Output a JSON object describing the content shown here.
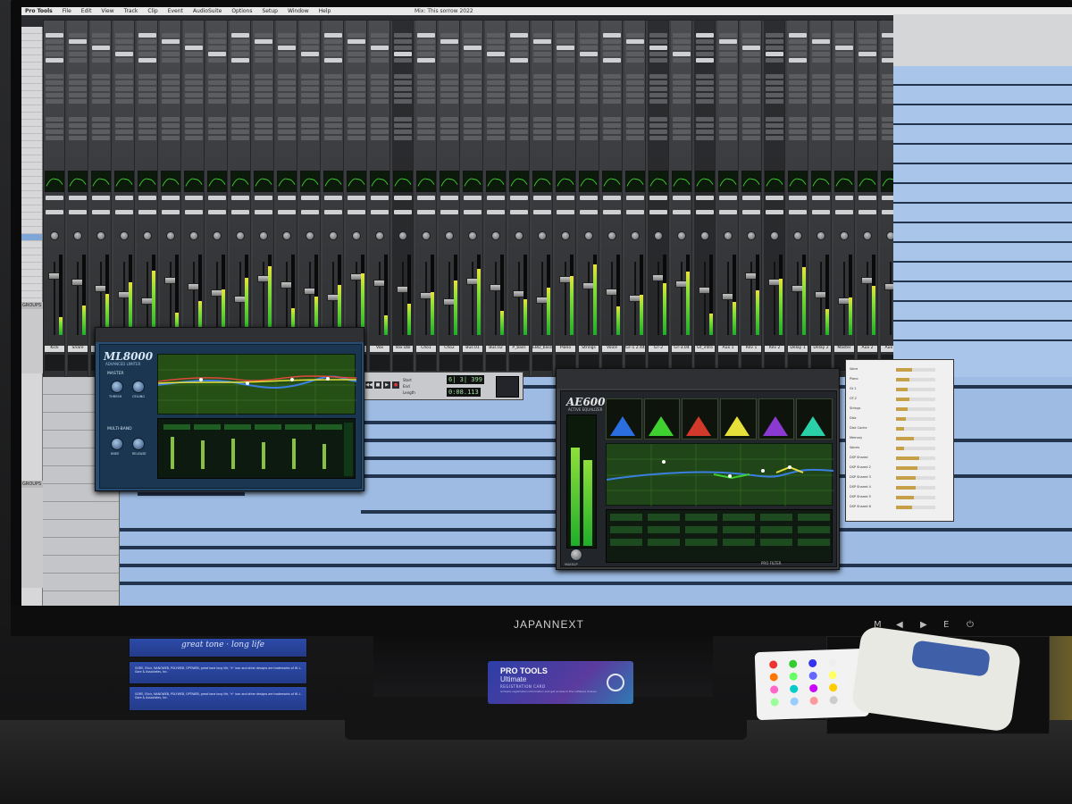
{
  "menubar": {
    "items": [
      "Pro Tools",
      "File",
      "Edit",
      "View",
      "Track",
      "Clip",
      "Event",
      "AudioSuite",
      "Options",
      "Setup",
      "Window",
      "Help"
    ],
    "title": "Mix: This sorrow 2022"
  },
  "tracklist": {
    "groups_label": "GROUPS",
    "groups_label_2": "GROUPS"
  },
  "mixer": {
    "strip_count": 37,
    "strip_names": [
      "Kick",
      "Snare",
      "Hat",
      "Tom1",
      "Tom2",
      "OH",
      "Room",
      "Bass",
      "Gtr1",
      "Gtr2",
      "Gtr3",
      "Keys",
      "Pad",
      "Str",
      "Vox",
      "Vox Dbl",
      "Cho1",
      "Cho2",
      "Bus.01",
      "Bus.02",
      "P_bass",
      "EBD_bass",
      "Piano",
      "Strings",
      "Voice",
      "GT-1 2.44",
      "GT-2",
      "GT-3.04",
      "Gt_intro",
      "Aux 1",
      "Rev 1",
      "Rev 2",
      "Delay 1",
      "Delay 2",
      "Master",
      "Aux 2",
      "Aux 3"
    ],
    "send_label": "SENDS F-J",
    "insert_label": "INSERTS A-E",
    "out_label": "Output 1-2",
    "group_label": "no group"
  },
  "transport": {
    "counter_main": "6| 3| 399",
    "counter_sub": "0:08.113",
    "start_label": "Start",
    "end_label": "End",
    "length_label": "Length"
  },
  "ml8000": {
    "title": "ML8000",
    "subtitle": "ADVANCED LIMITER",
    "master_label": "MASTER",
    "multiband_label": "MULTI-BAND",
    "knob1": "THRESH",
    "knob2": "CEILING",
    "knob3": "KNEE",
    "knob4": "RELEASE"
  },
  "ae600": {
    "title": "AE600",
    "subtitle": "ACTIVE EQUALIZER",
    "footer": "PRO FILTER",
    "makeup_label": "MAKEUP",
    "bands": [
      {
        "color": "#2a6ee0"
      },
      {
        "color": "#3fd12f"
      },
      {
        "color": "#d13a2a"
      },
      {
        "color": "#e6e03a"
      },
      {
        "color": "#8a3ad1"
      },
      {
        "color": "#2ad1a8"
      }
    ]
  },
  "usage": {
    "rows": [
      "Voice",
      "Piano",
      "Gt 1",
      "GT-2",
      "Strings",
      "Disk",
      "Disk Cache",
      "Memory",
      "Voices",
      "DSP Shared",
      "DSP Shared 2",
      "DSP Shared 3",
      "DSP Shared 4",
      "DSP Shared 5",
      "DSP Shared 6"
    ],
    "levels": [
      0.4,
      0.35,
      0.3,
      0.35,
      0.3,
      0.25,
      0.2,
      0.45,
      0.2,
      0.6,
      0.55,
      0.5,
      0.5,
      0.45,
      0.4
    ]
  },
  "monitor": {
    "brand": "JAPANNEXT",
    "osd": [
      "M",
      "◀",
      "▶",
      "E",
      "⏻"
    ]
  },
  "desk": {
    "card_line1": "PRO TOOLS",
    "card_line2": "Ultimate",
    "card_line3": "REGISTRATION CARD",
    "card_line4": "Activate registration information and get access to the software license",
    "strings_top": "great tone · long life",
    "strings_fine1": "GORE, Elixir, NANOWEB, POLYWEB, OPTIWEB, great tone long life, \"ε\" icon and other designs are trademarks of W. L. Gore & Associates, Inc.",
    "strings_fine2": "GORE, Elixir, NANOWEB, POLYWEB, OPTIWEB, great tone long life, \"ε\" icon and other designs are trademarks of W. L. Gore & Associates, Inc."
  },
  "colors": {
    "edit_bg": "#9ebce3",
    "waveform": "#23344f",
    "eq_green": "#3fd12f"
  }
}
